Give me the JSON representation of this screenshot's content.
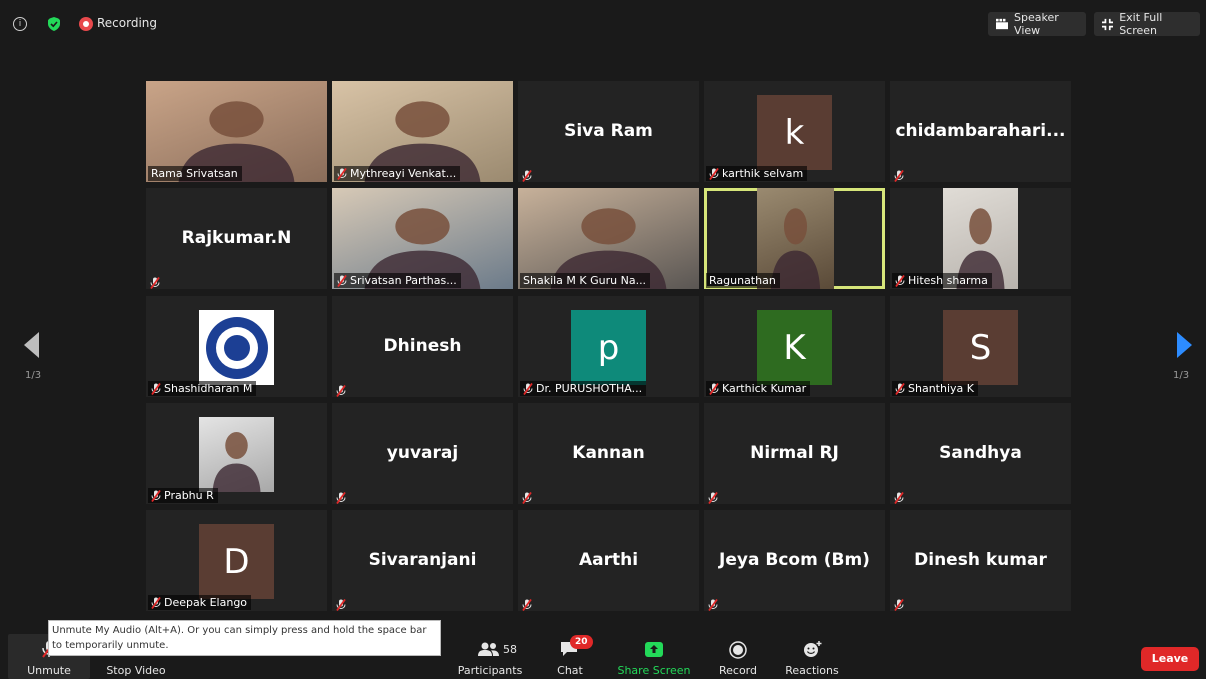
{
  "topbar": {
    "recording_label": "Recording",
    "speaker_view_label": "Speaker View",
    "exit_full_screen_label": "Exit Full Screen"
  },
  "pagination": {
    "left": "1/3",
    "right": "1/3"
  },
  "tiles": [
    {
      "name": "Rama Srivatsan",
      "display": "",
      "muted": false,
      "kind": "photo"
    },
    {
      "name": "Mythreayi Venkat...",
      "display": "",
      "muted": true,
      "kind": "photo"
    },
    {
      "name": "",
      "display": "Siva Ram",
      "muted": true,
      "kind": "text"
    },
    {
      "name": "karthik selvam",
      "display": "",
      "muted": true,
      "kind": "avatar",
      "avatar": "k",
      "color": "#5a3d33"
    },
    {
      "name": "",
      "display": "chidambarahari...",
      "muted": true,
      "kind": "text"
    },
    {
      "name": "",
      "display": "Rajkumar.N",
      "muted": true,
      "kind": "text"
    },
    {
      "name": "Srivatsan Parthas...",
      "display": "",
      "muted": true,
      "kind": "photo"
    },
    {
      "name": "Shakila M K Guru Na...",
      "display": "",
      "muted": false,
      "kind": "photo"
    },
    {
      "name": "Ragunathan",
      "display": "",
      "muted": false,
      "kind": "photo",
      "speaking": true
    },
    {
      "name": "Hitesh sharma",
      "display": "",
      "muted": true,
      "kind": "photo"
    },
    {
      "name": "Shashidharan M",
      "display": "",
      "muted": true,
      "kind": "logo"
    },
    {
      "name": "",
      "display": "Dhinesh",
      "muted": true,
      "kind": "text"
    },
    {
      "name": "Dr. PURUSHOTHA...",
      "display": "",
      "muted": true,
      "kind": "avatar",
      "avatar": "p",
      "color": "#0e8a7a"
    },
    {
      "name": "Karthick Kumar",
      "display": "",
      "muted": true,
      "kind": "avatar",
      "avatar": "K",
      "color": "#2e6b20"
    },
    {
      "name": "Shanthiya K",
      "display": "",
      "muted": true,
      "kind": "avatar",
      "avatar": "S",
      "color": "#5a3d33"
    },
    {
      "name": "Prabhu R",
      "display": "",
      "muted": true,
      "kind": "photo"
    },
    {
      "name": "",
      "display": "yuvaraj",
      "muted": true,
      "kind": "text"
    },
    {
      "name": "",
      "display": "Kannan",
      "muted": true,
      "kind": "text"
    },
    {
      "name": "",
      "display": "Nirmal RJ",
      "muted": true,
      "kind": "text"
    },
    {
      "name": "",
      "display": "Sandhya",
      "muted": true,
      "kind": "text"
    },
    {
      "name": "Deepak Elango",
      "display": "",
      "muted": true,
      "kind": "avatar",
      "avatar": "D",
      "color": "#5a3d33"
    },
    {
      "name": "",
      "display": "Sivaranjani",
      "muted": true,
      "kind": "text"
    },
    {
      "name": "",
      "display": "Aarthi",
      "muted": true,
      "kind": "text"
    },
    {
      "name": "",
      "display": "Jeya Bcom (Bm)",
      "muted": true,
      "kind": "text"
    },
    {
      "name": "",
      "display": "Dinesh kumar",
      "muted": true,
      "kind": "text"
    }
  ],
  "bottombar": {
    "unmute": "Unmute",
    "stop_video": "Stop Video",
    "participants": "Participants",
    "participants_count": "58",
    "chat": "Chat",
    "chat_badge": "20",
    "share_screen": "Share Screen",
    "record": "Record",
    "reactions": "Reactions",
    "leave": "Leave"
  },
  "tooltip": "Unmute My Audio (Alt+A). Or you can simply press and hold the space bar to temporarily unmute.",
  "colors": {
    "accent": "#2d8cff",
    "leave": "#e02828",
    "share": "#23d959",
    "speaking_border": "#d6e57a"
  }
}
